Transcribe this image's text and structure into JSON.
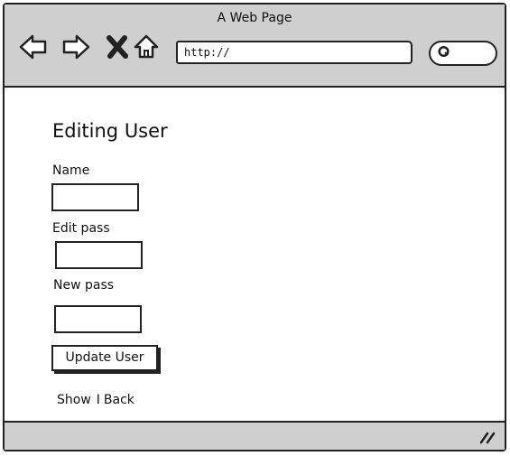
{
  "window": {
    "title": "A Web Page"
  },
  "toolbar": {
    "url_value": "http://",
    "icons": [
      "back-arrow-icon",
      "forward-arrow-icon",
      "close-icon",
      "home-icon",
      "search-icon",
      "resize-grip-icon"
    ]
  },
  "form": {
    "heading": "Editing User",
    "fields": [
      {
        "label": "Name",
        "value": ""
      },
      {
        "label": "Edit pass",
        "value": ""
      },
      {
        "label": "New pass",
        "value": ""
      }
    ],
    "submit_label": "Update User"
  },
  "links": {
    "show": "Show",
    "separator": "I",
    "back": "Back"
  }
}
